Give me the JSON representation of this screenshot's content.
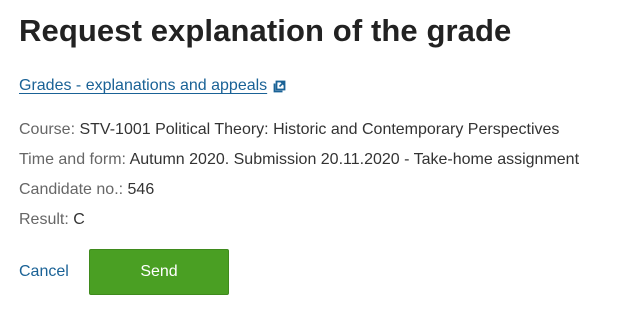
{
  "page": {
    "title": "Request explanation of the grade"
  },
  "info_link": {
    "label": "Grades - explanations and appeals",
    "icon": "external-link-icon"
  },
  "details": {
    "course": {
      "label": "Course:",
      "value": "STV-1001 Political Theory: Historic and Contemporary Perspectives"
    },
    "time_form": {
      "label": "Time and form:",
      "value": "Autumn 2020. Submission 20.11.2020 - Take-home assignment"
    },
    "candidate": {
      "label": "Candidate no.:",
      "value": "546"
    },
    "result": {
      "label": "Result:",
      "value": "C"
    }
  },
  "actions": {
    "cancel_label": "Cancel",
    "send_label": "Send"
  },
  "colors": {
    "link": "#1a6296",
    "send_button": "#4a9f23",
    "text": "#222222",
    "label": "#666666"
  }
}
